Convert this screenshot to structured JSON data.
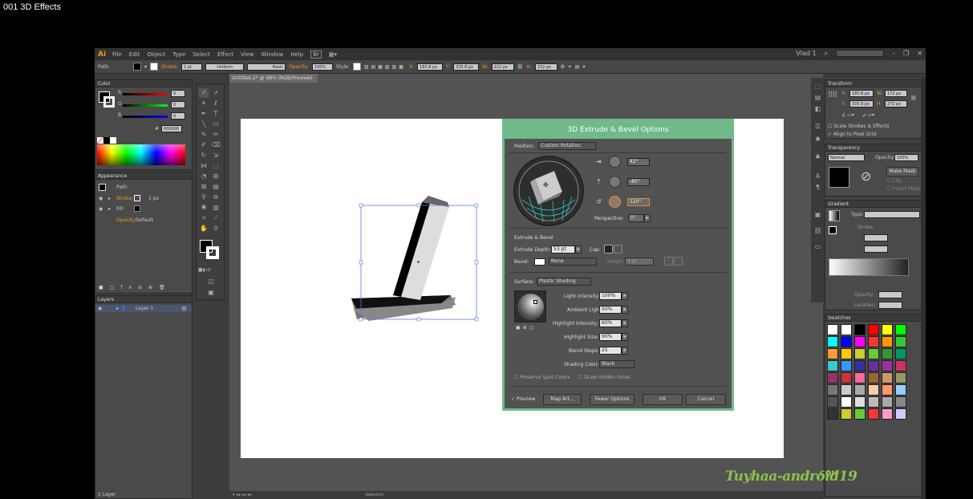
{
  "video_title": "001 3D Effects",
  "app": {
    "logo": "Ai",
    "menu": [
      "File",
      "Edit",
      "Object",
      "Type",
      "Select",
      "Effect",
      "View",
      "Window",
      "Help"
    ],
    "workspace": "Vlad 1",
    "colors": {
      "accent": "#f7941d",
      "dialog_border": "#6fb98a",
      "watermark": "#8bc34a"
    }
  },
  "control_bar": {
    "object": "Path",
    "stroke_label": "Stroke:",
    "stroke_value": "1 pt",
    "uniform": "Uniform",
    "basic": "Basic",
    "opacity_label": "Opacity:",
    "opacity_value": "100%",
    "style_label": "Style:",
    "x_label": "X:",
    "x_value": "180.8 px",
    "y_label": "Y:",
    "y_value": "335.8 px",
    "w_label": "W:",
    "w_value": "222 px",
    "h_label": "H:",
    "h_value": "232 px"
  },
  "color_panel": {
    "tab": "Color",
    "r_value": "0",
    "g_value": "0",
    "b_value": "0",
    "hex": "000000"
  },
  "appearance_panel": {
    "tab": "Appearance",
    "object": "Path",
    "stroke_label": "Stroke:",
    "stroke_value": "1 px",
    "fill_label": "Fill:",
    "opacity_label": "Opacity:",
    "opacity_value": "Default"
  },
  "layers_panel": {
    "tab": "Layers",
    "layer": "Layer 1",
    "footer": "1 Layer"
  },
  "document": {
    "tab": "Untitled-2* @ 98% (RGB/Preview)",
    "status": "Selection"
  },
  "dialog": {
    "title": "3D Extrude & Bevel Options",
    "position_label": "Position:",
    "position_value": "Custom Rotation",
    "angle_x": "42°",
    "angle_y": "-85°",
    "angle_z": "120°",
    "perspective_label": "Perspective:",
    "perspective_value": "0°",
    "extrude_section": "Extrude & Bevel",
    "extrude_depth_label": "Extrude Depth:",
    "extrude_depth_value": "53 pt",
    "cap_label": "Cap:",
    "bevel_label": "Bevel:",
    "bevel_value": "None",
    "height_label": "Height:",
    "height_value": "4 pt",
    "surface_label": "Surface:",
    "surface_value": "Plastic Shading",
    "light_intensity_label": "Light Intensity:",
    "light_intensity_value": "100%",
    "ambient_label": "Ambient Light:",
    "ambient_value": "50%",
    "highlight_intensity_label": "Highlight Intensity:",
    "highlight_intensity_value": "60%",
    "highlight_size_label": "Highlight Size:",
    "highlight_size_value": "90%",
    "blend_steps_label": "Blend Steps:",
    "blend_steps_value": "25",
    "shading_color_label": "Shading Color:",
    "shading_color_value": "Black",
    "preserve_spot": "Preserve Spot Colors",
    "draw_hidden": "Draw Hidden Faces",
    "preview": "Preview",
    "map_art": "Map Art...",
    "fewer_options": "Fewer Options",
    "ok": "OK",
    "cancel": "Cancel"
  },
  "transform_panel": {
    "tab": "Transform",
    "x_label": "X:",
    "x_value": "180.8 px",
    "y_label": "Y:",
    "y_value": "335.8 px",
    "w_label": "W:",
    "w_value": "172 px",
    "h_label": "H:",
    "h_value": "272 px",
    "scale_strokes": "Scale Strokes & Effects",
    "align_pixel": "Align to Pixel Grid"
  },
  "transparency_panel": {
    "tab": "Transparency",
    "mode": "Normal",
    "opacity_label": "Opacity:",
    "opacity_value": "100%",
    "make_mask": "Make Mask",
    "clip": "Clip",
    "invert_mask": "Invert Mask"
  },
  "gradient_panel": {
    "tab": "Gradient",
    "type_label": "Type:",
    "stroke_label": "Stroke:",
    "opacity_label": "Opacity:",
    "location_label": "Location:"
  },
  "swatches_panel": {
    "tab": "Swatches",
    "rows": [
      [
        "#ffffff",
        "#ffffff",
        "#000000",
        "#ff0000",
        "#ffff00",
        "#00ff00"
      ],
      [
        "#00ffff",
        "#0000ff",
        "#ff00ff",
        "#ff3333",
        "#ff9900",
        "#33cc33"
      ],
      [
        "#ff9933",
        "#ffcc00",
        "#cccc33",
        "#66cc33",
        "#339933",
        "#009966"
      ],
      [
        "#33cccc",
        "#3399ff",
        "#333399",
        "#663399",
        "#993399",
        "#cc3366"
      ],
      [
        "#993366",
        "#cc3333",
        "#ff6699",
        "#996633",
        "#cc9966",
        "#999966"
      ],
      [
        "#777777",
        "#cccccc",
        "#aaaaaa",
        "#ffccaa",
        "#ff9966",
        "#99ccff"
      ],
      [
        "#555555",
        "#ffffff",
        "#dddddd",
        "#bbbbbb",
        "#aaaaaa",
        "#888888"
      ],
      [
        "#333333",
        "#cccc33",
        "#66cc33",
        "#ff3333",
        "#ff99cc",
        "#ccccff"
      ]
    ]
  },
  "watermark": {
    "text": "Tuyhaa-android19",
    "sub": "COM"
  }
}
